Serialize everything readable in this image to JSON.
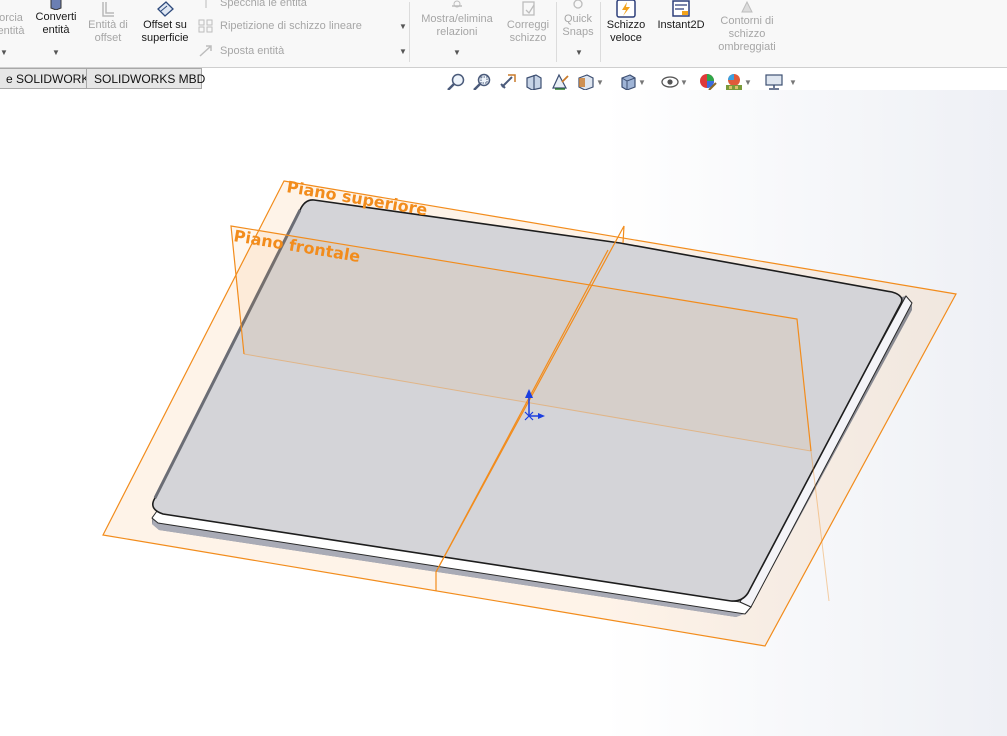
{
  "ribbon": {
    "forza_entita": {
      "line1": "orcia",
      "line2": "entità"
    },
    "converti_entita": {
      "line1": "Converti",
      "line2": "entità"
    },
    "entita_offset": {
      "line1": "Entità di",
      "line2": "offset"
    },
    "offset_superficie": {
      "line1": "Offset su",
      "line2": "superficie"
    },
    "specchia": "Specchia le entità",
    "ripetizione": "Ripetizione di schizzo lineare",
    "sposta": "Sposta entità",
    "mostra_relazioni": {
      "line1": "Mostra/elimina",
      "line2": "relazioni"
    },
    "correggi_schizzo": {
      "line1": "Correggi",
      "line2": "schizzo"
    },
    "quick_snaps": {
      "line1": "Quick",
      "line2": "Snaps"
    },
    "schizzo_veloce": {
      "line1": "Schizzo",
      "line2": "veloce"
    },
    "instant2d": "Instant2D",
    "contorni": {
      "line1": "Contorni di",
      "line2": "schizzo",
      "line3": "ombreggiati"
    }
  },
  "tabs": [
    "e SOLIDWORKS",
    "SOLIDWORKS MBD"
  ],
  "view_toolbar": [
    "zoom-to-fit-icon",
    "zoom-to-area-icon",
    "previous-view-icon",
    "section-view-icon",
    "dynamic-annotation-icon",
    "view-orientation-icon",
    "display-style-icon",
    "hide-show-items-icon",
    "edit-appearance-icon",
    "apply-scene-icon",
    "view-settings-icon"
  ],
  "scene": {
    "plane_top_label": "Piano superiore",
    "plane_front_label": "Piano frontale",
    "plane_color": "#f28c1c",
    "part_color": "#d4d4d8",
    "axis_y_color": "#1b3ee0"
  }
}
